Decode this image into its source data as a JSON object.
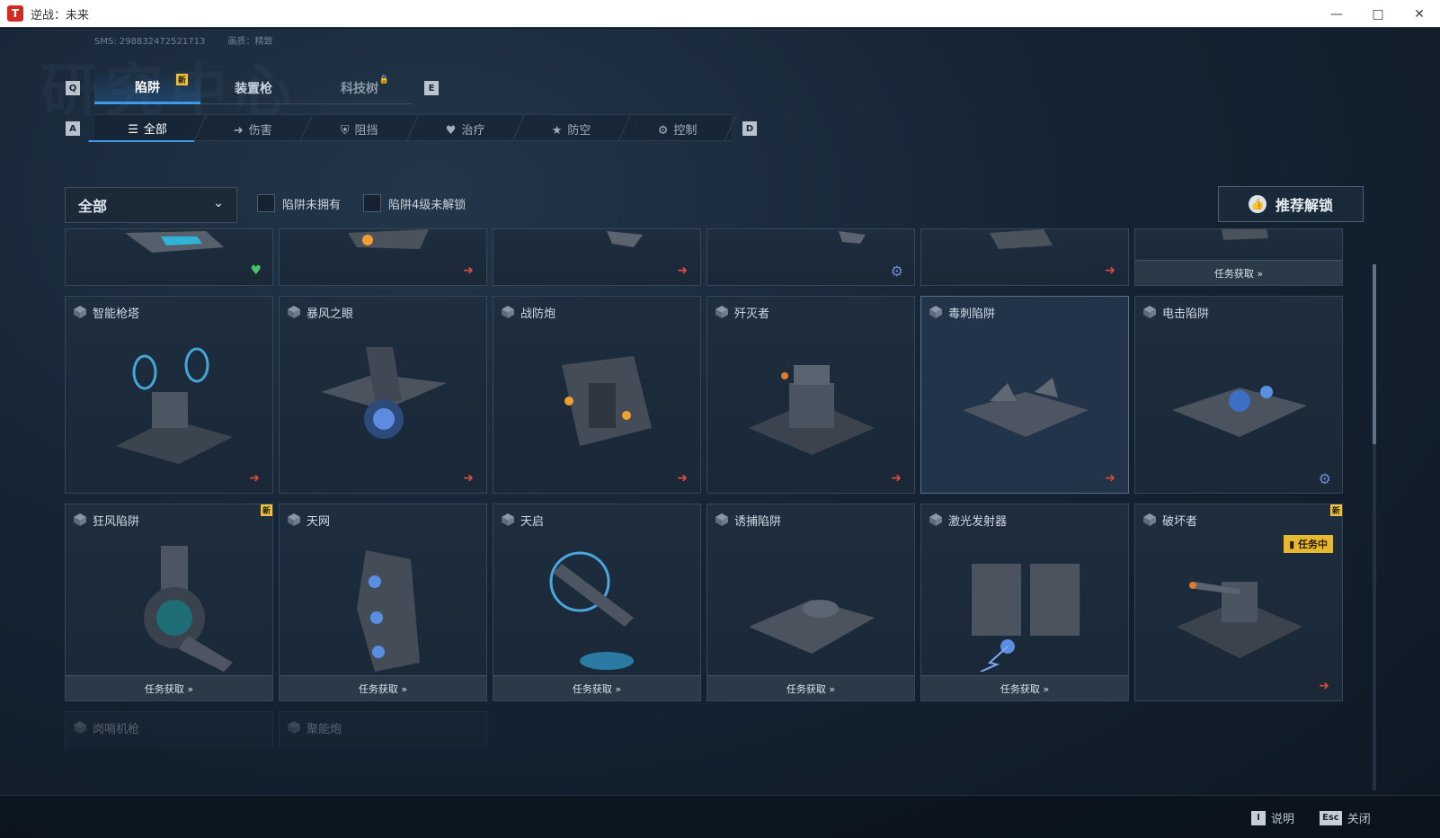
{
  "window": {
    "title": "逆战：未来"
  },
  "header": {
    "watermark": "研究中心",
    "sms_label": "SMS: 298832472521713",
    "quality_label": "画质：精致"
  },
  "keys": {
    "prev_tab": "Q",
    "next_tab": "E",
    "prev_sub": "A",
    "next_sub": "D"
  },
  "main_tabs": [
    {
      "label": "陷阱",
      "badge": "新"
    },
    {
      "label": "装置枪"
    },
    {
      "label": "科技树"
    }
  ],
  "sub_tabs": [
    {
      "label": "全部",
      "icon": "list-icon"
    },
    {
      "label": "伤害",
      "icon": "arrow-icon"
    },
    {
      "label": "阻挡",
      "icon": "shield-icon"
    },
    {
      "label": "治疗",
      "icon": "heart-icon"
    },
    {
      "label": "防空",
      "icon": "badge-icon"
    },
    {
      "label": "控制",
      "icon": "gear-icon"
    }
  ],
  "filters": {
    "dropdown_value": "全部",
    "checkbox_unowned": "陷阱未拥有",
    "checkbox_lv4": "陷阱4级未解锁",
    "recommend_button": "推荐解锁"
  },
  "top_row": [
    {
      "icon": "heart-icon"
    },
    {
      "icon": "arrow-icon"
    },
    {
      "icon": "arrow-icon"
    },
    {
      "icon": "gear-icon"
    },
    {
      "icon": "arrow-icon"
    },
    {
      "task": "任务获取 »"
    }
  ],
  "row1": [
    {
      "name": "智能枪塔",
      "icon": "arrow-icon"
    },
    {
      "name": "暴风之眼",
      "icon": "arrow-icon"
    },
    {
      "name": "战防炮",
      "icon": "arrow-icon"
    },
    {
      "name": "歼灭者",
      "icon": "arrow-icon"
    },
    {
      "name": "毒刺陷阱",
      "icon": "arrow-icon"
    },
    {
      "name": "电击陷阱",
      "icon": "gear-icon"
    }
  ],
  "row2": [
    {
      "name": "狂风陷阱",
      "task": "任务获取 »",
      "badge": "新"
    },
    {
      "name": "天网",
      "task": "任务获取 »"
    },
    {
      "name": "天启",
      "task": "任务获取 »"
    },
    {
      "name": "诱捕陷阱",
      "task": "任务获取 »"
    },
    {
      "name": "激光发射器",
      "task": "任务获取 »"
    },
    {
      "name": "破坏者",
      "status": "任务中",
      "badge": "新",
      "icon": "arrow-icon"
    }
  ],
  "row3": [
    {
      "name": "岗哨机枪"
    },
    {
      "name": "聚能炮"
    }
  ],
  "footer": {
    "help_key": "I",
    "help_label": "说明",
    "close_key": "Esc",
    "close_label": "关闭"
  },
  "colors": {
    "accent": "#3d9be9",
    "new_badge": "#e8c24a",
    "arrow": "#d24b46",
    "heal": "#4bbf6a"
  }
}
